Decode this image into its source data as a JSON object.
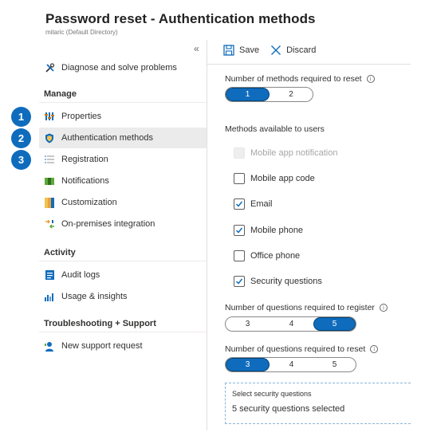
{
  "header": {
    "title": "Password reset - Authentication methods",
    "subtitle": "mitaric (Default Directory)"
  },
  "sidebar": {
    "collapse_glyph": "«",
    "diagnose": {
      "label": "Diagnose and solve problems",
      "icon": "wrench-icon"
    },
    "sections": {
      "manage": "Manage",
      "activity": "Activity",
      "support": "Troubleshooting + Support"
    },
    "manage_items": [
      {
        "label": "Properties",
        "icon": "properties-icon"
      },
      {
        "label": "Authentication methods",
        "icon": "shield-icon"
      },
      {
        "label": "Registration",
        "icon": "list-icon"
      },
      {
        "label": "Notifications",
        "icon": "notification-icon"
      },
      {
        "label": "Customization",
        "icon": "customization-icon"
      },
      {
        "label": "On-premises integration",
        "icon": "integration-icon"
      }
    ],
    "activity_items": [
      {
        "label": "Audit logs",
        "icon": "audit-log-icon"
      },
      {
        "label": "Usage & insights",
        "icon": "insights-chart-icon"
      }
    ],
    "support_items": [
      {
        "label": "New support request",
        "icon": "support-person-icon"
      }
    ],
    "active_item": "Authentication methods"
  },
  "badges": [
    "1",
    "2",
    "3"
  ],
  "toolbar": {
    "save_label": "Save",
    "discard_label": "Discard"
  },
  "methods_required": {
    "label": "Number of methods required to reset",
    "options": [
      "1",
      "2"
    ],
    "selected": "1"
  },
  "methods_available": {
    "label": "Methods available to users",
    "items": [
      {
        "label": "Mobile app notification",
        "checked": false,
        "disabled": true
      },
      {
        "label": "Mobile app code",
        "checked": false,
        "disabled": false
      },
      {
        "label": "Email",
        "checked": true,
        "disabled": false
      },
      {
        "label": "Mobile phone",
        "checked": true,
        "disabled": false
      },
      {
        "label": "Office phone",
        "checked": false,
        "disabled": false
      },
      {
        "label": "Security questions",
        "checked": true,
        "disabled": false
      }
    ]
  },
  "questions_register": {
    "label": "Number of questions required to register",
    "options": [
      "3",
      "4",
      "5"
    ],
    "selected": "5"
  },
  "questions_reset": {
    "label": "Number of questions required to reset",
    "options": [
      "3",
      "4",
      "5"
    ],
    "selected": "3"
  },
  "security_questions": {
    "label": "Select security questions",
    "value": "5 security questions selected"
  },
  "colors": {
    "accent": "#0f6cbd",
    "active_nav_bg": "#ebebeb"
  }
}
